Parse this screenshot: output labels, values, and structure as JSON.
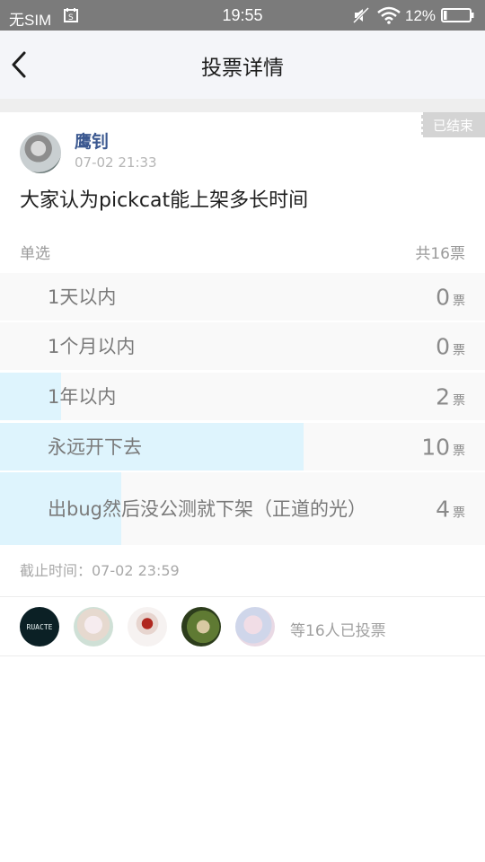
{
  "status_bar": {
    "carrier": "无SIM",
    "time": "19:55",
    "battery": "12%",
    "icons": [
      "sim-card-icon",
      "mute-icon",
      "wifi-icon",
      "battery-icon"
    ]
  },
  "nav": {
    "title": "投票详情",
    "back_icon": "chevron-left-icon"
  },
  "post": {
    "status_badge": "已结束",
    "author": "鹰钊",
    "time": "07-02 21:33",
    "question": "大家认为pickcat能上架多长时间"
  },
  "poll": {
    "type": "单选",
    "total_label": "共16票",
    "vote_unit": "票",
    "options": [
      {
        "label": "1天以内",
        "votes": "0",
        "fraction": 0
      },
      {
        "label": "1个月以内",
        "votes": "0",
        "fraction": 0
      },
      {
        "label": "1年以内",
        "votes": "2",
        "fraction": 0.125
      },
      {
        "label": "永远开下去",
        "votes": "10",
        "fraction": 0.625
      },
      {
        "label": "出bug然后没公测就下架（正道的光）",
        "votes": "4",
        "fraction": 0.25
      }
    ],
    "deadline": "截止时间：07-02 23:59"
  },
  "voters": {
    "avatar_label_1": "RUACTE",
    "summary": "等16人已投票"
  },
  "colors": {
    "accent_name": "#3b5890",
    "bar_fill": "#def4fd",
    "status_bar_bg": "#7b7b7b"
  }
}
